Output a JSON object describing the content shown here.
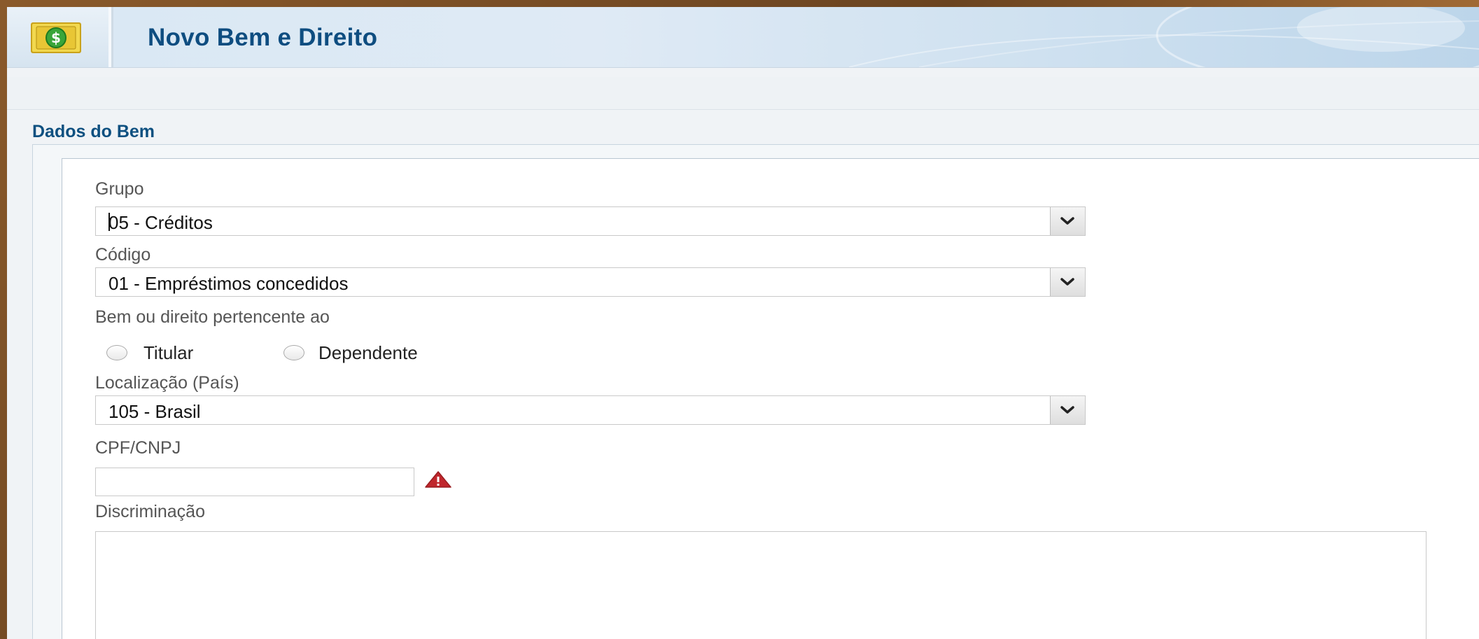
{
  "header": {
    "title": "Novo Bem e Direito",
    "icon": "money-icon"
  },
  "section": {
    "title": "Dados do Bem"
  },
  "form": {
    "grupo": {
      "label": "Grupo",
      "value": "05 - Créditos"
    },
    "codigo": {
      "label": "Código",
      "value": "01 - Empréstimos concedidos"
    },
    "pertencente": {
      "label": "Bem ou direito pertencente ao",
      "options": [
        "Titular",
        "Dependente"
      ],
      "selected": null
    },
    "localizacao": {
      "label": "Localização (País)",
      "value": "105 - Brasil"
    },
    "cpf": {
      "label": "CPF/CNPJ",
      "value": "",
      "status_icon": "warning-icon",
      "status_color": "#c0272d"
    },
    "discriminacao": {
      "label": "Discriminação",
      "value": ""
    }
  },
  "colors": {
    "title": "#0e4d80",
    "accent_green": "#3aa53a"
  }
}
